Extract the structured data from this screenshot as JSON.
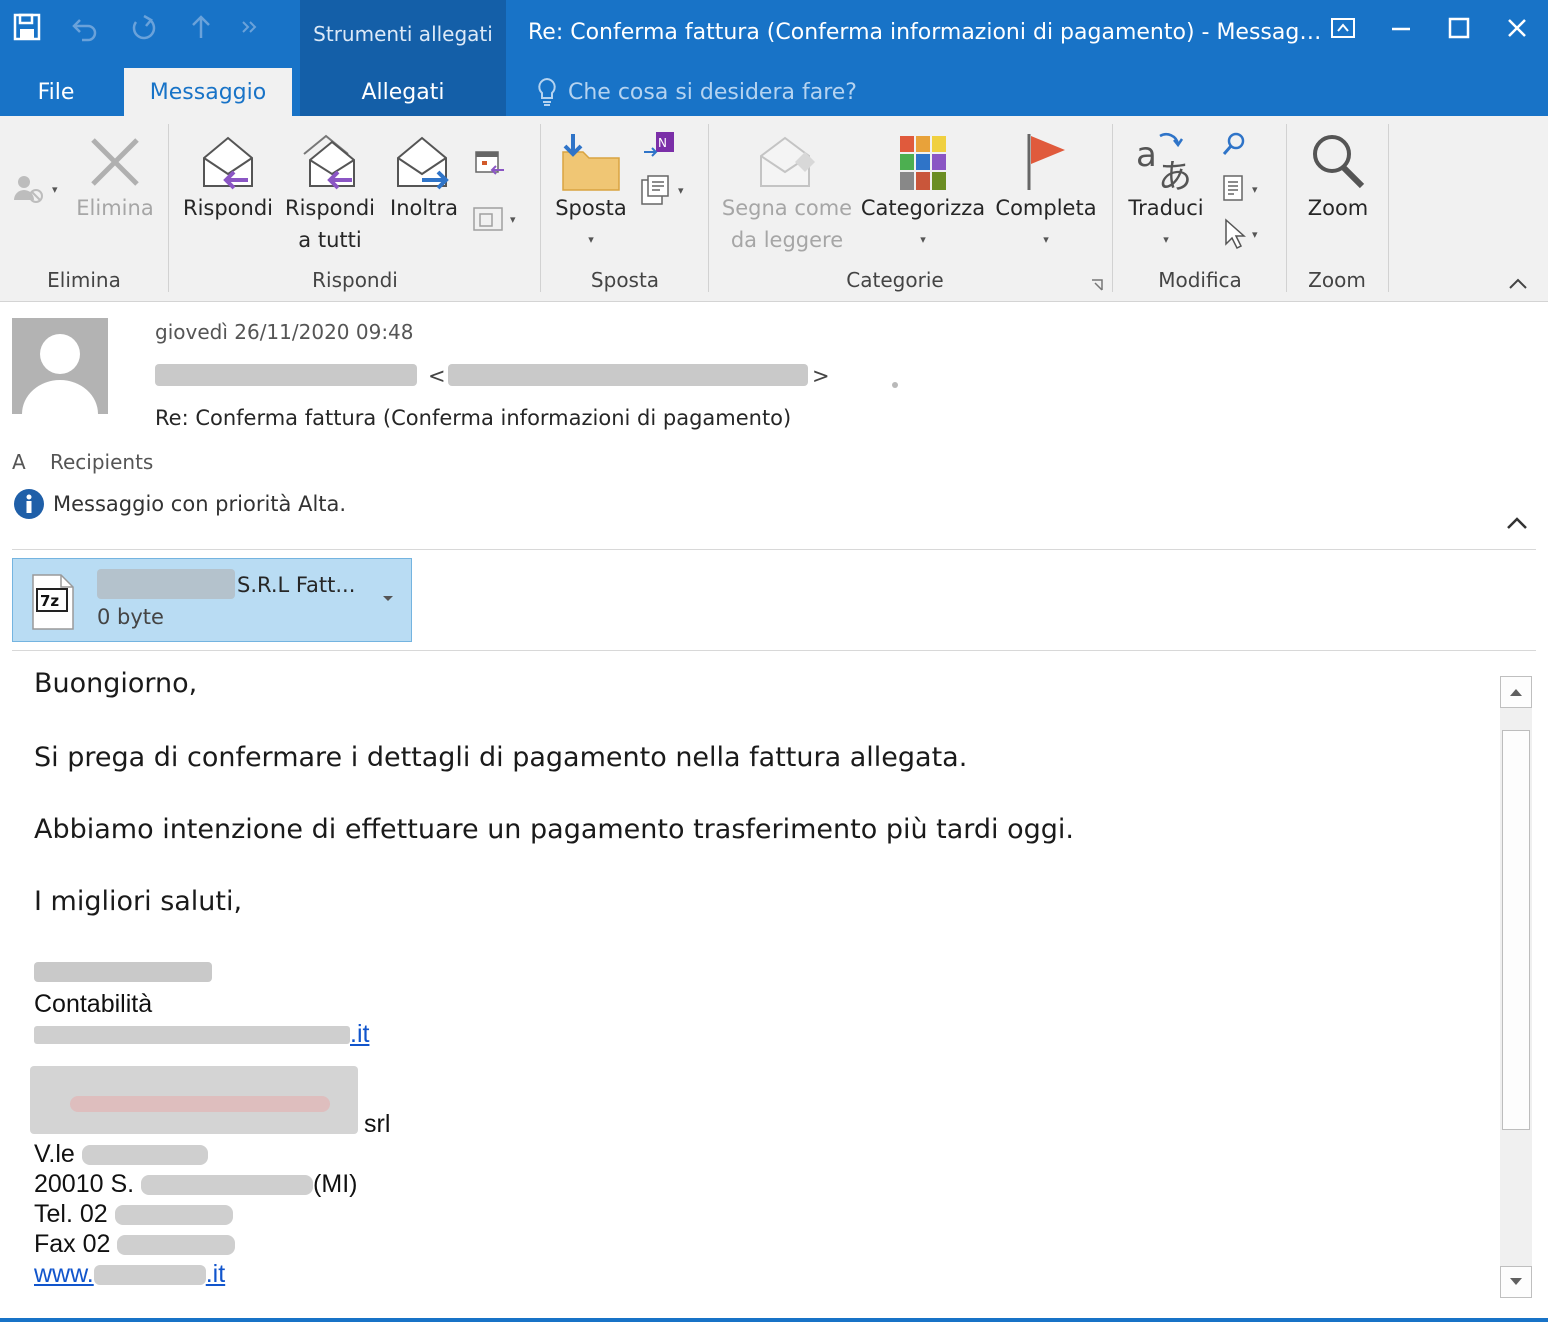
{
  "colors": {
    "accent": "#1873c7",
    "context_tab": "#145fa8",
    "attachment_bg": "#b9dcf3",
    "flag": "#e05a3c"
  },
  "window": {
    "title": "Re: Conferma fattura (Conferma informazioni di pagamento) - Messag…",
    "context_group": "Strumenti allegati"
  },
  "tabs": {
    "file": "File",
    "messaggio": "Messaggio",
    "allegati": "Allegati"
  },
  "tell_me": {
    "placeholder": "Che cosa si desidera fare?"
  },
  "ribbon": {
    "elimina": {
      "delete_label": "Elimina",
      "group": "Elimina"
    },
    "rispondi": {
      "reply": "Rispondi",
      "reply_all_line1": "Rispondi",
      "reply_all_line2": "a tutti",
      "forward": "Inoltra",
      "group": "Rispondi"
    },
    "sposta": {
      "move": "Sposta",
      "group": "Sposta"
    },
    "categorie": {
      "mark_line1": "Segna come",
      "mark_line2": "da leggere",
      "categorize": "Categorizza",
      "followup": "Completa",
      "group": "Categorie"
    },
    "modifica": {
      "translate": "Traduci",
      "group": "Modifica"
    },
    "zoom": {
      "zoom": "Zoom",
      "group": "Zoom"
    }
  },
  "message": {
    "date": "giovedì 26/11/2020 09:48",
    "sender_open": "<",
    "sender_close": ">",
    "subject": "Re: Conferma fattura (Conferma informazioni di pagamento)",
    "to_label": "A",
    "to_value": "Recipients",
    "priority_notice": "Messaggio con priorità Alta."
  },
  "attachment": {
    "name_suffix": "S.R.L Fatt...",
    "size": "0 byte",
    "icon_label": "7z"
  },
  "body": {
    "greeting": "Buongiorno,",
    "line1": "Si prega di confermare i dettagli di pagamento nella fattura allegata.",
    "line2": "Abbiamo intenzione di effettuare un pagamento trasferimento più tardi oggi.",
    "closing": "I migliori saluti,"
  },
  "signature": {
    "department": "Contabilità",
    "email_suffix": ".it",
    "company_suffix": "srl",
    "address_prefix": "V.le",
    "city_prefix": "20010 S.",
    "city_suffix": "(MI)",
    "tel_prefix": "Tel. 02",
    "fax_prefix": "Fax 02",
    "web_prefix": "www.",
    "web_suffix": ".it"
  }
}
